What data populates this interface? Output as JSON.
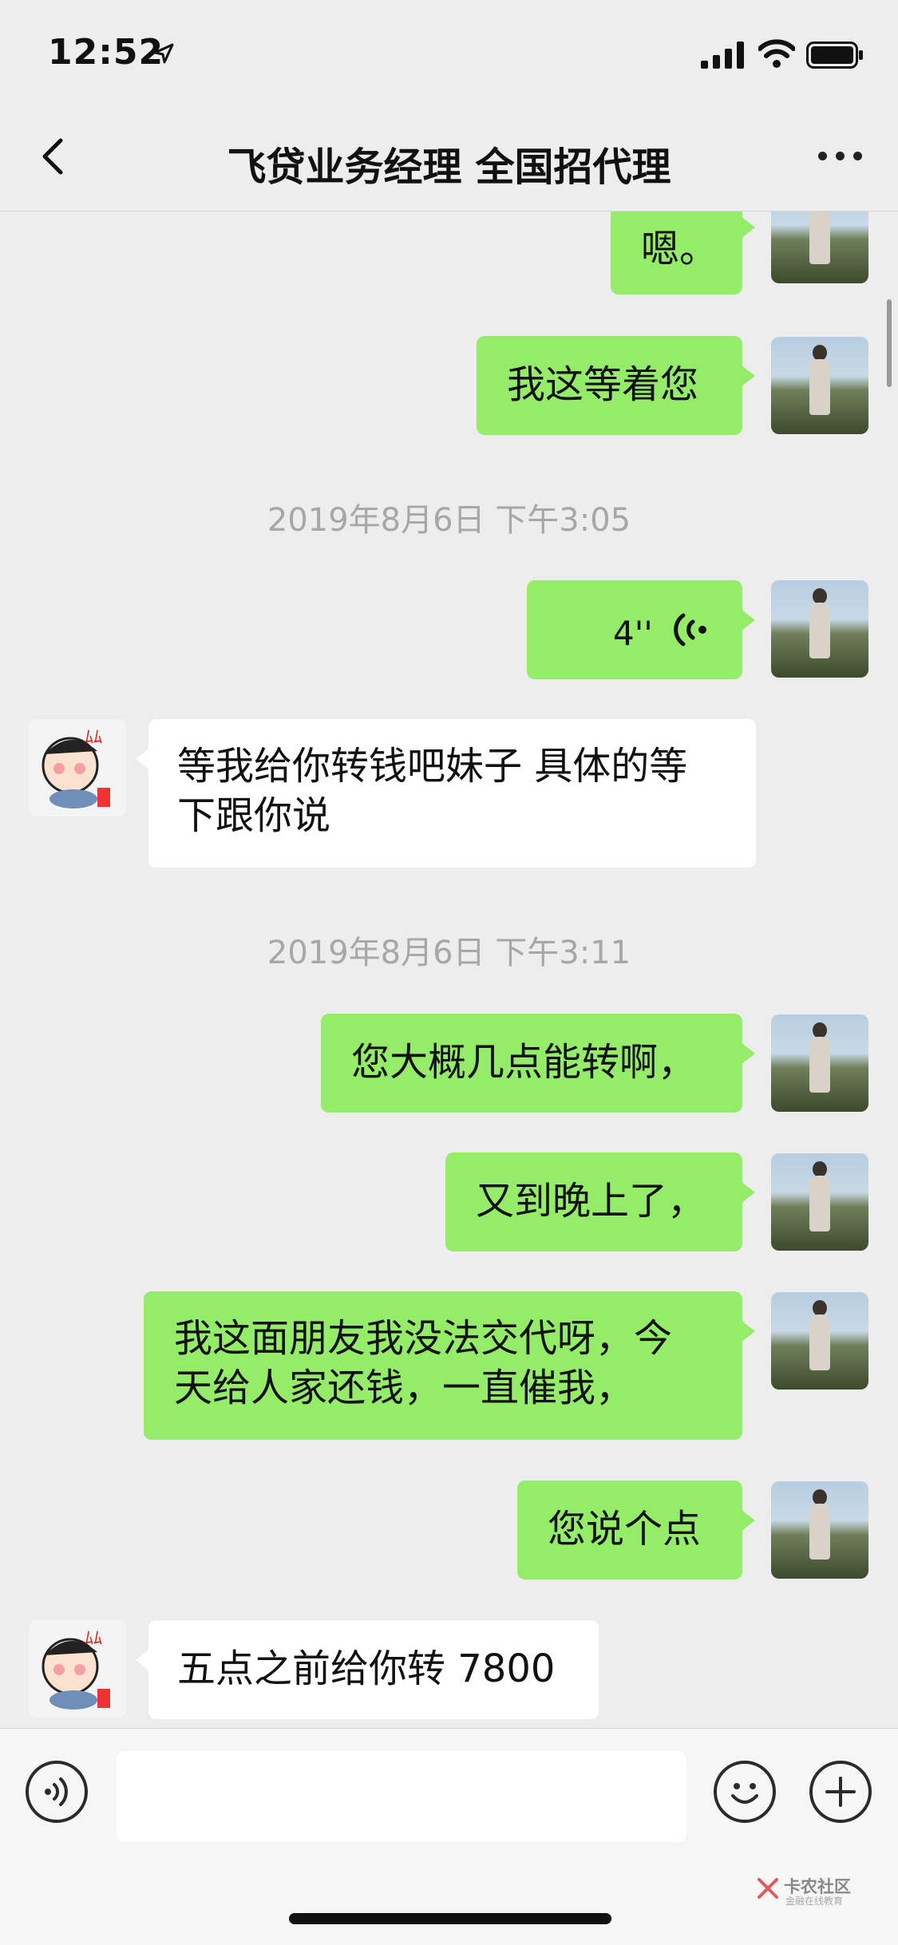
{
  "status_bar": {
    "time": "12:52"
  },
  "nav": {
    "title": "飞贷业务经理 全国招代理"
  },
  "messages": {
    "m1": "嗯。",
    "m2": "我这等着您",
    "ts1": "2019年8月6日 下午3:05",
    "voice_duration": "4''",
    "m3_line1": "等我给你转钱吧妹子 具体的等",
    "m3_line2": "下跟你说",
    "ts2": "2019年8月6日 下午3:11",
    "m4": "您大概几点能转啊，",
    "m5": "又到晚上了，",
    "m6_line1": "我这面朋友我没法交代呀，今",
    "m6_line2": "天给人家还钱，一直催我，",
    "m7": "您说个点",
    "m8": "五点之前给你转 7800"
  },
  "input": {
    "value": ""
  },
  "watermark": {
    "title": "卡农社区",
    "subtitle": "金融在线教育"
  },
  "colors": {
    "my_bubble": "#95ec69",
    "their_bubble": "#ffffff",
    "background": "#ededed"
  }
}
